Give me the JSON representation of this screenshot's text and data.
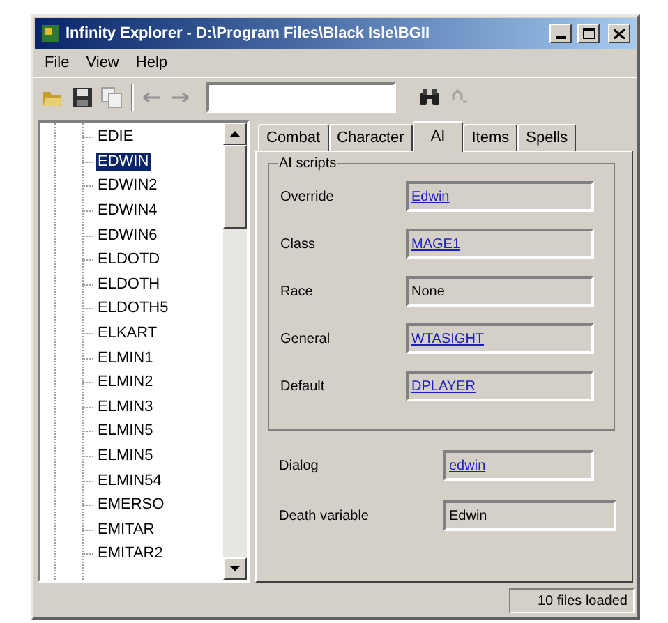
{
  "window": {
    "title": "Infinity Explorer - D:\\Program Files\\Black Isle\\BGII"
  },
  "menu": [
    "File",
    "View",
    "Help"
  ],
  "tree": {
    "items": [
      {
        "label": "EDIE",
        "selected": false
      },
      {
        "label": "EDWIN",
        "selected": true
      },
      {
        "label": "EDWIN2",
        "selected": false
      },
      {
        "label": "EDWIN4",
        "selected": false
      },
      {
        "label": "EDWIN6",
        "selected": false
      },
      {
        "label": "ELDOTD",
        "selected": false
      },
      {
        "label": "ELDOTH",
        "selected": false
      },
      {
        "label": "ELDOTH5",
        "selected": false
      },
      {
        "label": "ELKART",
        "selected": false
      },
      {
        "label": "ELMIN1",
        "selected": false
      },
      {
        "label": "ELMIN2",
        "selected": false
      },
      {
        "label": "ELMIN3",
        "selected": false
      },
      {
        "label": "ELMIN5",
        "selected": false
      },
      {
        "label": "ELMIN5",
        "selected": false
      },
      {
        "label": "ELMIN54",
        "selected": false
      },
      {
        "label": "EMERSO",
        "selected": false
      },
      {
        "label": "EMITAR",
        "selected": false
      },
      {
        "label": "EMITAR2",
        "selected": false
      }
    ]
  },
  "tabs": [
    {
      "label": "Combat",
      "selected": false
    },
    {
      "label": "Character",
      "selected": false
    },
    {
      "label": "AI",
      "selected": true
    },
    {
      "label": "Items",
      "selected": false
    },
    {
      "label": "Spells",
      "selected": false
    }
  ],
  "ai_scripts": {
    "title": "AI scripts",
    "fields": [
      {
        "label": "Override",
        "value": "Edwin",
        "kind": "link"
      },
      {
        "label": "Class",
        "value": "MAGE1",
        "kind": "link"
      },
      {
        "label": "Race",
        "value": "None",
        "kind": "text"
      },
      {
        "label": "General",
        "value": "WTASIGHT",
        "kind": "link"
      },
      {
        "label": "Default",
        "value": "DPLAYER",
        "kind": "link"
      }
    ]
  },
  "other_fields": [
    {
      "label": "Dialog",
      "value": "edwin",
      "kind": "link"
    },
    {
      "label": "Death variable",
      "value": "Edwin",
      "kind": "text"
    }
  ],
  "status_bar": "10 files loaded"
}
